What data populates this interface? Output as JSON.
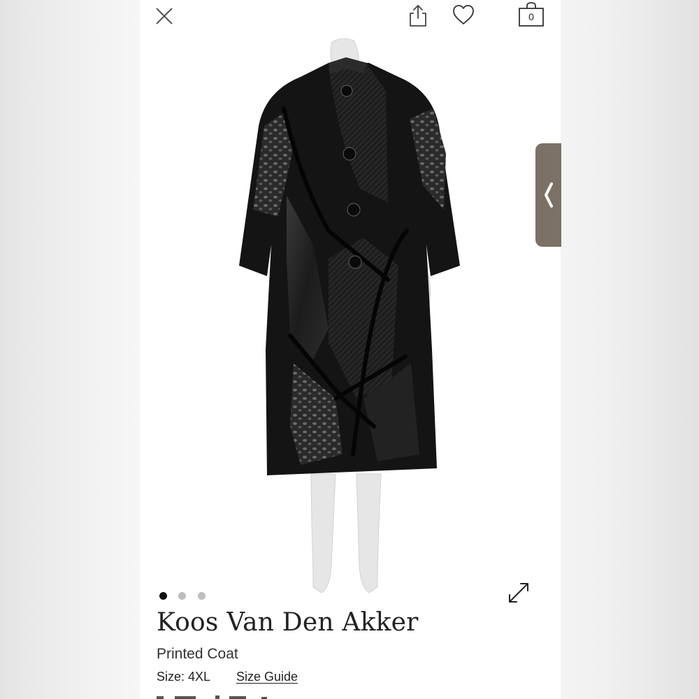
{
  "header": {
    "close_icon": "close-icon",
    "share_icon": "share-icon",
    "favorite_icon": "heart-icon",
    "bag_icon": "shopping-bag-icon",
    "bag_count": "0"
  },
  "side_tab": {
    "icon": "chevron-left-icon",
    "color": "#7b7166"
  },
  "gallery": {
    "image_count": 3,
    "active_index": 0,
    "expand_icon": "expand-arrows-icon"
  },
  "product": {
    "designer": "Koos Van Den Akker",
    "name": "Printed Coat",
    "size_label": "Size: 4XL",
    "size_guide_label": "Size Guide"
  },
  "colors": {
    "accent_dot_active": "#111111",
    "dot_inactive": "#bdbdbd",
    "coat": "#141414"
  }
}
